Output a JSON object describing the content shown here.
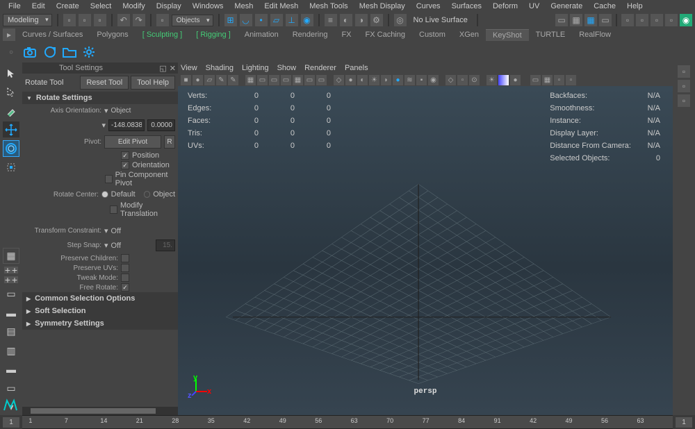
{
  "menubar": [
    "File",
    "Edit",
    "Create",
    "Select",
    "Modify",
    "Display",
    "Windows",
    "Mesh",
    "Edit Mesh",
    "Mesh Tools",
    "Mesh Display",
    "Curves",
    "Surfaces",
    "Deform",
    "UV",
    "Generate",
    "Cache",
    "Help"
  ],
  "status": {
    "mode": "Modeling",
    "objects_label": "Objects",
    "live_surface": "No Live Surface"
  },
  "shelves": [
    "Curves / Surfaces",
    "Polygons",
    "Sculpting",
    "Rigging",
    "Animation",
    "Rendering",
    "FX",
    "FX Caching",
    "Custom",
    "XGen",
    "KeyShot",
    "TURTLE",
    "RealFlow"
  ],
  "active_shelf": "KeyShot",
  "green_shelves": [
    "Sculpting",
    "Rigging"
  ],
  "tool_settings": {
    "panel_title": "Tool Settings",
    "tool_name": "Rotate Tool",
    "reset_btn": "Reset Tool",
    "help_btn": "Tool Help",
    "rotate_settings": "Rotate Settings",
    "axis_label": "Axis Orientation:",
    "axis_value": "Object",
    "num1": "-148.0838",
    "num2": "0.0000",
    "pivot_label": "Pivot:",
    "edit_pivot": "Edit Pivot",
    "reset_r": "R",
    "cb_position": "Position",
    "cb_orientation": "Orientation",
    "cb_pin": "Pin Component Pivot",
    "rotate_center": "Rotate Center:",
    "rc_default": "Default",
    "rc_object": "Object",
    "cb_modify": "Modify Translation",
    "tc_label": "Transform Constraint:",
    "tc_value": "Off",
    "ss_label": "Step Snap:",
    "ss_value": "Off",
    "ss_num": "15.",
    "preserve_children": "Preserve Children:",
    "preserve_uvs": "Preserve UVs:",
    "tweak_mode": "Tweak Mode:",
    "free_rotate": "Free Rotate:",
    "common_sel": "Common Selection Options",
    "soft_sel": "Soft Selection",
    "symmetry": "Symmetry Settings"
  },
  "vp_menu": [
    "View",
    "Shading",
    "Lighting",
    "Show",
    "Renderer",
    "Panels"
  ],
  "hud_left": {
    "rows": [
      {
        "label": "Verts:",
        "v1": "0",
        "v2": "0",
        "v3": "0"
      },
      {
        "label": "Edges:",
        "v1": "0",
        "v2": "0",
        "v3": "0"
      },
      {
        "label": "Faces:",
        "v1": "0",
        "v2": "0",
        "v3": "0"
      },
      {
        "label": "Tris:",
        "v1": "0",
        "v2": "0",
        "v3": "0"
      },
      {
        "label": "UVs:",
        "v1": "0",
        "v2": "0",
        "v3": "0"
      }
    ]
  },
  "hud_right": {
    "rows": [
      {
        "label": "Backfaces:",
        "val": "N/A"
      },
      {
        "label": "Smoothness:",
        "val": "N/A"
      },
      {
        "label": "Instance:",
        "val": "N/A"
      },
      {
        "label": "Display Layer:",
        "val": "N/A"
      },
      {
        "label": "Distance From Camera:",
        "val": "N/A"
      },
      {
        "label": "Selected Objects:",
        "val": "0"
      }
    ]
  },
  "camera_name": "persp",
  "axes": {
    "x": "x",
    "y": "y",
    "z": "z"
  },
  "timeline": {
    "start": "1",
    "end": "1",
    "ticks": [
      1,
      7,
      14,
      21,
      28,
      35,
      42,
      49,
      56,
      63,
      70,
      77,
      84,
      91,
      42,
      49,
      56,
      63
    ]
  }
}
